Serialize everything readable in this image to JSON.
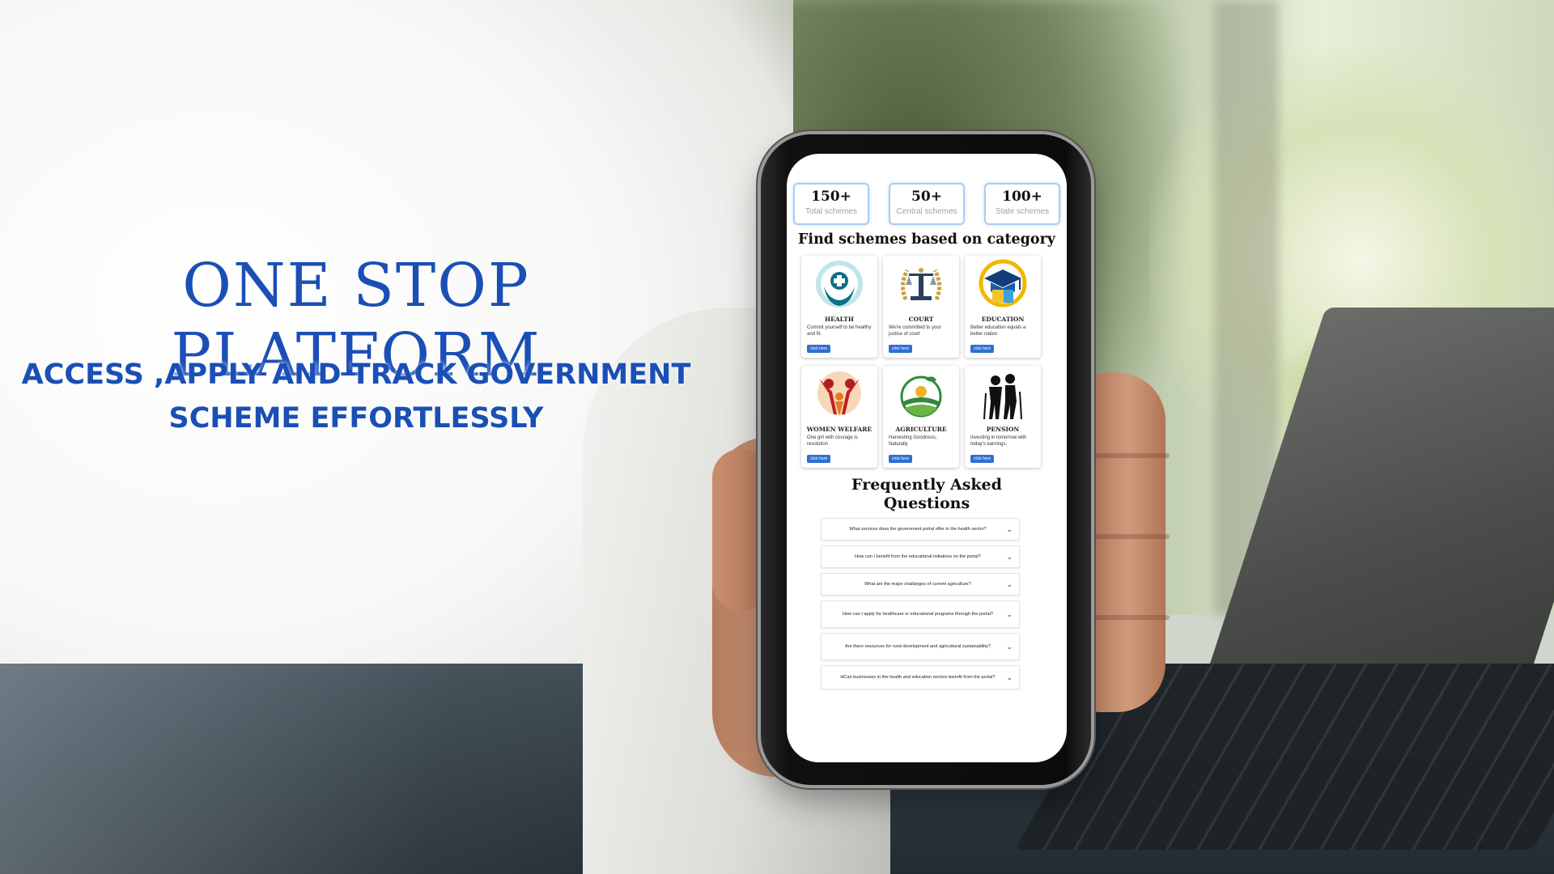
{
  "banner": {
    "headline": "ONE STOP PLATFORM",
    "subhead_line1": "ACCESS ,APPLY AND TRACK GOVERNMENT",
    "subhead_line2": "SCHEME EFFORTLESSLY",
    "accent_color": "#1a4fb5"
  },
  "stats": [
    {
      "value": "150+",
      "label": "Total schemes"
    },
    {
      "value": "50+",
      "label": "Central schemes"
    },
    {
      "value": "100+",
      "label": "State schemes"
    }
  ],
  "categories": {
    "title": "Find schemes based on category",
    "items": [
      {
        "name": "HEALTH",
        "desc": "Commit yourself to be healthy and fit.",
        "button": "click here",
        "icon": "health-icon"
      },
      {
        "name": "COURT",
        "desc": "We're committed to your justice of court",
        "button": "click here",
        "icon": "court-icon"
      },
      {
        "name": "EDUCATION",
        "desc": "Better education equals a better nation",
        "button": "click here",
        "icon": "education-icon"
      },
      {
        "name": "WOMEN WELFARE",
        "desc": "One girl with courage is revolution",
        "button": "click here",
        "icon": "women-welfare-icon"
      },
      {
        "name": "AGRICULTURE",
        "desc": "Harvesting Goodness, Naturally",
        "button": "click here",
        "icon": "agriculture-icon"
      },
      {
        "name": "PENSION",
        "desc": "Investing in tomorrow with today's earnings.",
        "button": "click here",
        "icon": "pension-icon"
      }
    ]
  },
  "faq": {
    "title_line1": "Frequently Asked",
    "title_line2": "Questions",
    "items": [
      "What services does the government portal offer in the health sector?",
      "How can I benefit from the educational initiatives on the portal?",
      "What are the major challanges of current agriculture?",
      "How can I apply for healthcare or educational programs through the portal?",
      "Are there resources for rural development and agricultural sustainability?",
      "HCan businesses in the health and education sectors benefit from the portal?"
    ]
  },
  "colors": {
    "button": "#2f6fd1",
    "stat_border": "#a9cdf3"
  }
}
